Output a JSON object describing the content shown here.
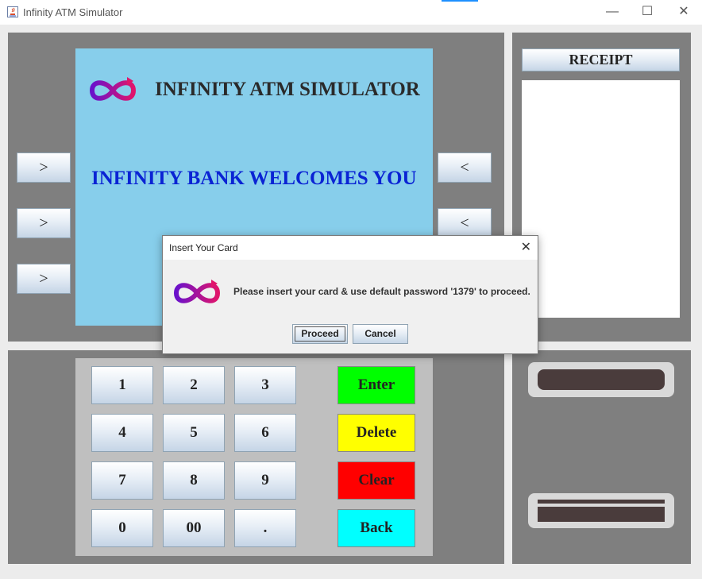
{
  "window": {
    "title": "Infinity ATM Simulator",
    "minimize_glyph": "—",
    "maximize_glyph": "☐",
    "close_glyph": "✕"
  },
  "screen": {
    "title": "INFINITY ATM SIMULATOR",
    "welcome": "INFINITY BANK WELCOMES YOU",
    "background": "#87ceeb"
  },
  "side_buttons": {
    "left": [
      ">",
      ">",
      ">"
    ],
    "right": [
      "<",
      "<"
    ]
  },
  "receipt": {
    "title": "RECEIPT"
  },
  "keypad": {
    "keys": [
      "1",
      "2",
      "3",
      "4",
      "5",
      "6",
      "7",
      "8",
      "9",
      "0",
      "00",
      "."
    ],
    "enter": "Enter",
    "delete": "Delete",
    "clear": "Clear",
    "back": "Back",
    "colors": {
      "enter": "#00ff00",
      "delete": "#ffff00",
      "clear": "#ff0000",
      "back": "#00ffff"
    }
  },
  "dialog": {
    "title": "Insert Your Card",
    "message": "Please insert your card & use default password '1379' to proceed.",
    "proceed_label": "Proceed",
    "cancel_label": "Cancel",
    "close_glyph": "✕"
  },
  "icons": {
    "logo": "infinity-logo-icon",
    "app": "java-app-icon"
  }
}
